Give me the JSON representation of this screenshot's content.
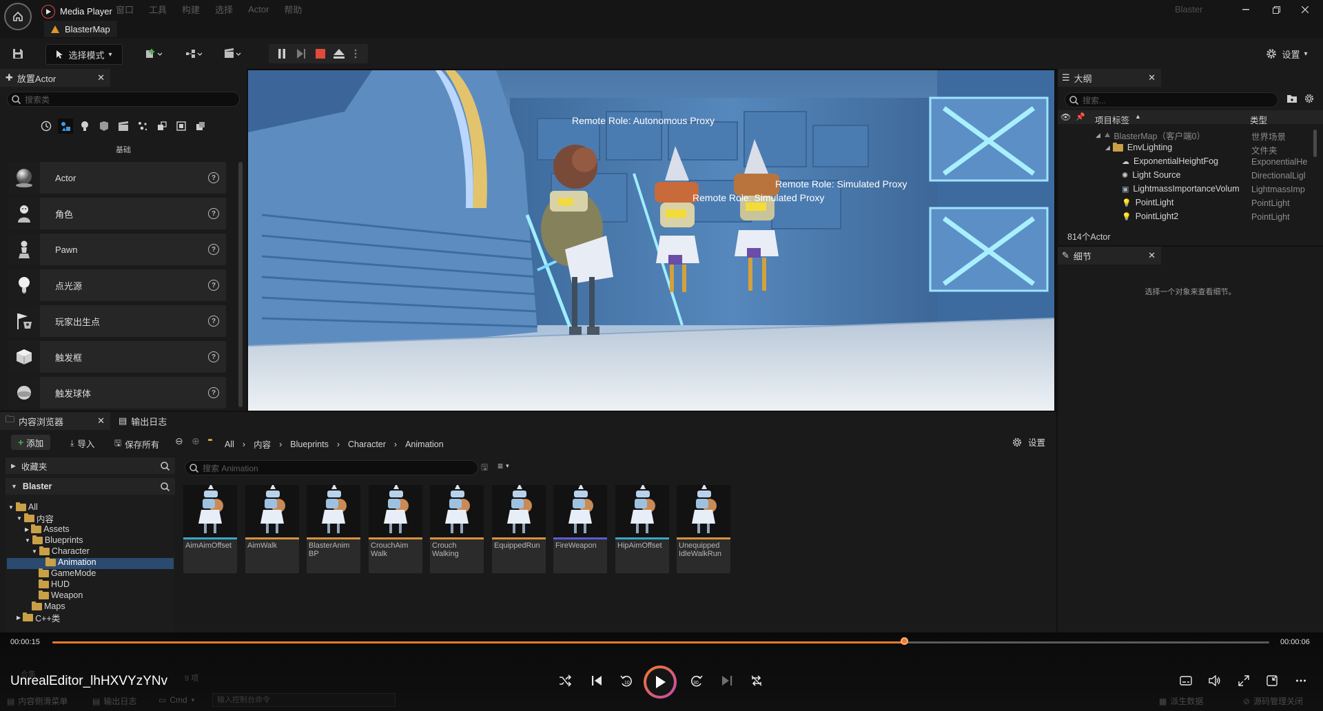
{
  "titlebar": {
    "app_name": "Media Player",
    "menu": [
      "窗口",
      "工具",
      "构建",
      "选择",
      "Actor",
      "帮助"
    ],
    "project_name": "Blaster",
    "map_tab": "BlasterMap"
  },
  "toolbar": {
    "select_mode": "选择模式",
    "settings": "设置"
  },
  "place_actor": {
    "tab": "放置Actor",
    "search_placeholder": "搜索类",
    "category": "基础",
    "items": [
      {
        "label": "Actor",
        "icon": "sphere-icon"
      },
      {
        "label": "角色",
        "icon": "character-icon"
      },
      {
        "label": "Pawn",
        "icon": "pawn-icon"
      },
      {
        "label": "点光源",
        "icon": "point-light-icon"
      },
      {
        "label": "玩家出生点",
        "icon": "player-start-icon"
      },
      {
        "label": "触发框",
        "icon": "trigger-box-icon"
      },
      {
        "label": "触发球体",
        "icon": "trigger-sphere-icon"
      }
    ]
  },
  "viewport": {
    "labels": [
      "Remote Role: Autonomous Proxy",
      "Remote Role: Simulated Proxy",
      "Remote Role: Simulated Proxy"
    ]
  },
  "outliner": {
    "tab": "大纲",
    "search_placeholder": "搜索...",
    "col_label": "项目标签",
    "col_type": "类型",
    "rows": [
      {
        "label": "BlasterMap（客户端0）",
        "type": "世界场景"
      },
      {
        "label": "EnvLighting",
        "type": "文件夹"
      },
      {
        "label": "ExponentialHeightFog",
        "type": "ExponentialHe"
      },
      {
        "label": "Light Source",
        "type": "DirectionalLigl"
      },
      {
        "label": "LightmassImportanceVolum",
        "type": "LightmassImp"
      },
      {
        "label": "PointLight",
        "type": "PointLight"
      },
      {
        "label": "PointLight2",
        "type": "PointLight"
      }
    ],
    "count": "814个Actor"
  },
  "details": {
    "tab": "细节",
    "empty_msg": "选择一个对象来查看细节。"
  },
  "content_browser": {
    "tab": "内容浏览器",
    "output_tab": "输出日志",
    "add": "添加",
    "import": "导入",
    "save_all": "保存所有",
    "breadcrumb": [
      "All",
      "内容",
      "Blueprints",
      "Character",
      "Animation"
    ],
    "settings": "设置",
    "favorites": "收藏夹",
    "project": "Blaster",
    "search_placeholder": "搜索 Animation",
    "tree": [
      "All",
      "内容",
      "Assets",
      "Blueprints",
      "Character",
      "Animation",
      "GameMode",
      "HUD",
      "Weapon",
      "Maps",
      "C++类"
    ],
    "assets": [
      {
        "line1": "AimAimOffset",
        "line2": "",
        "bar": "#39a7c9"
      },
      {
        "line1": "AimWalk",
        "line2": "",
        "bar": "#d9913a"
      },
      {
        "line1": "BlasterAnim",
        "line2": "BP",
        "bar": "#d9913a"
      },
      {
        "line1": "CrouchAim",
        "line2": "Walk",
        "bar": "#d9913a"
      },
      {
        "line1": "Crouch",
        "line2": "Walking",
        "bar": "#d9913a"
      },
      {
        "line1": "EquippedRun",
        "line2": "",
        "bar": "#d9913a"
      },
      {
        "line1": "FireWeapon",
        "line2": "",
        "bar": "#5b5bd6"
      },
      {
        "line1": "HipAimOffset",
        "line2": "",
        "bar": "#39a7c9"
      },
      {
        "line1": "Unequipped",
        "line2": "IdleWalkRun",
        "bar": "#d9913a"
      }
    ],
    "item_count": "9 项",
    "collections": "合集"
  },
  "statusbar": {
    "drawer": "内容侧滑菜单",
    "output_log": "输出日志",
    "cmd": "Cmd",
    "console_placeholder": "输入控制台命令",
    "derived_data": "派生数据",
    "source_control": "源码管理关闭"
  },
  "player": {
    "current_time": "00:00:15",
    "total_time": "00:00:06",
    "progress": 0.7,
    "file_name": "UnrealEditor_lhHXVYzYNv",
    "accent": "#f07a2a"
  }
}
